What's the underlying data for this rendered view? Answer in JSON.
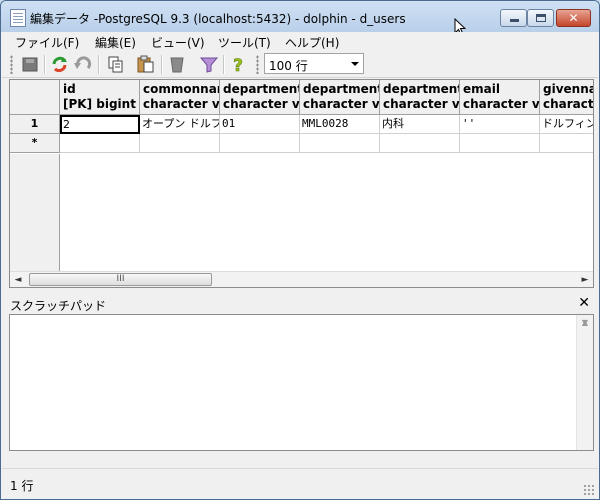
{
  "window": {
    "title": "編集データ -PostgreSQL 9.3 (localhost:5432) - dolphin - d_users",
    "close_glyph": "✕"
  },
  "menu": [
    "ファイル(F)",
    "編集(E)",
    "ビュー(V)",
    "ツール(T)",
    "ヘルプ(H)"
  ],
  "toolbar": {
    "row_limit": "100 行",
    "icons": [
      "save-icon",
      "refresh-icon",
      "undo-icon",
      "copy-icon",
      "paste-icon",
      "delete-row-icon",
      "filter-icon",
      "help-icon"
    ]
  },
  "grid": {
    "columns": [
      {
        "line1": "id",
        "line2": "[PK] bigint"
      },
      {
        "line1": "commonname",
        "line2": "character varying"
      },
      {
        "line1": "departmentid",
        "line2": "character varying"
      },
      {
        "line1": "departmentcode",
        "line2": "character varying"
      },
      {
        "line1": "departmentname",
        "line2": "character varying"
      },
      {
        "line1": "email",
        "line2": "character varying"
      },
      {
        "line1": "givenname",
        "line2": "character varying"
      }
    ],
    "rows": [
      {
        "header": "1",
        "cells": [
          "2",
          "オープン ドルフィン",
          "01",
          "MML0028",
          "内科",
          "''",
          "ドルフィン"
        ]
      }
    ],
    "new_row_marker": "*",
    "hscroll_thumb": "III",
    "scroll_left": "◄",
    "scroll_right": "►"
  },
  "scratchpad": {
    "title": "スクラッチパッド",
    "close": "✕",
    "scroll_up": "▲",
    "scroll_down": "▼"
  },
  "status": {
    "rows": "1 行"
  },
  "colors": {
    "title_bar": "#bfd4ec",
    "close_button": "#c4452c",
    "grid_border": "#8c8c8c"
  }
}
